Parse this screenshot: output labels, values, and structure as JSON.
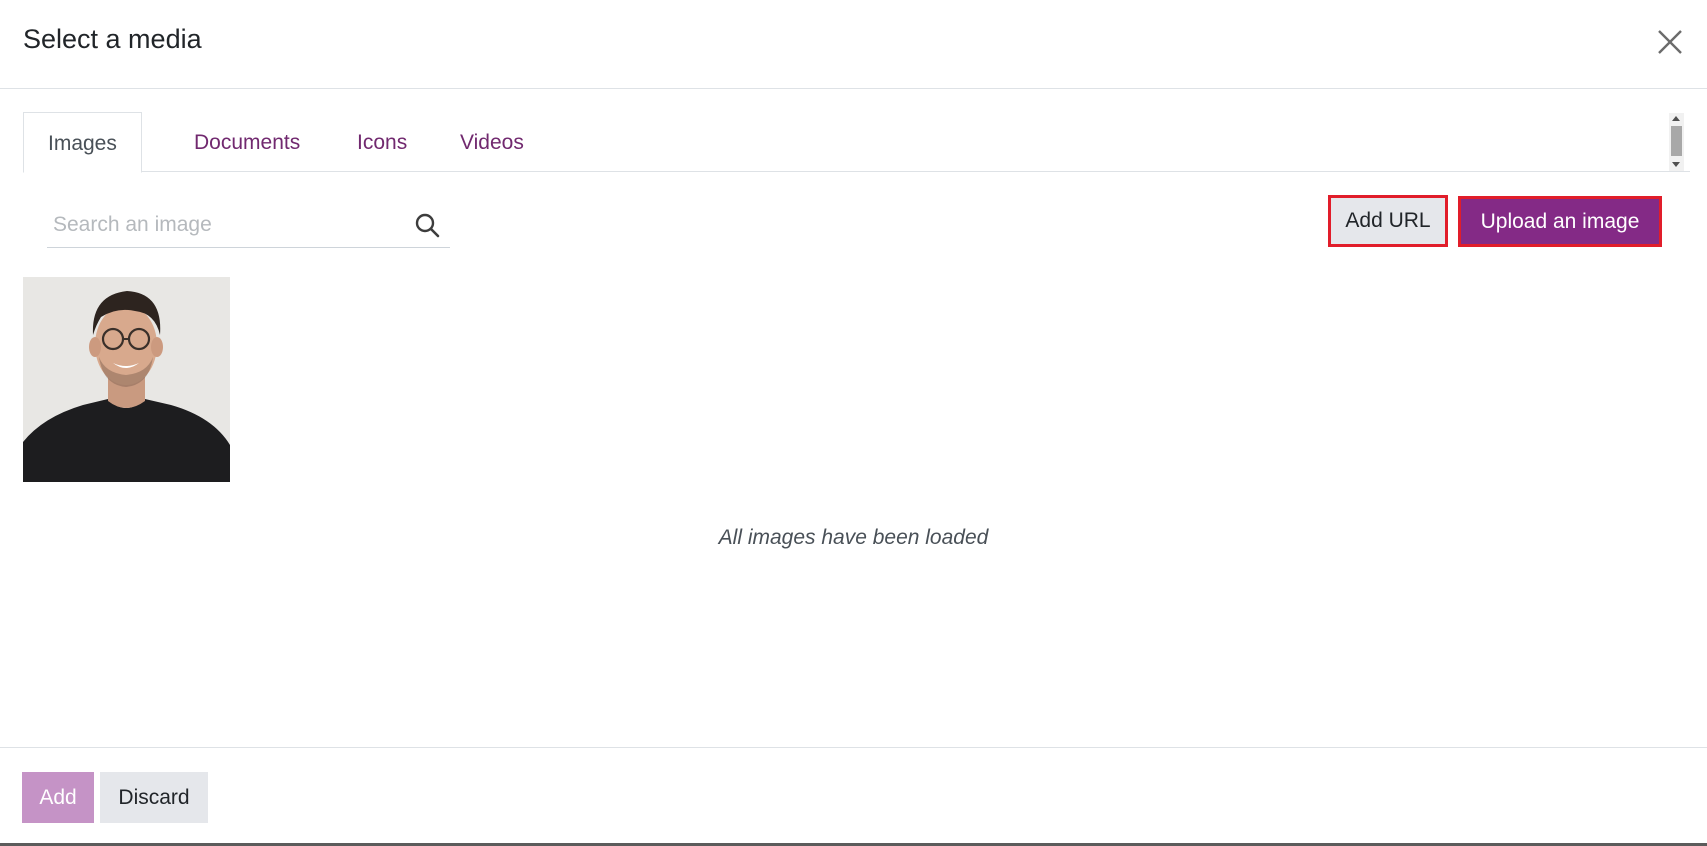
{
  "dialog": {
    "title": "Select a media",
    "close_label": "×"
  },
  "tabs": [
    {
      "label": "Images",
      "active": true
    },
    {
      "label": "Documents",
      "active": false
    },
    {
      "label": "Icons",
      "active": false
    },
    {
      "label": "Videos",
      "active": false
    }
  ],
  "search": {
    "placeholder": "Search an image",
    "value": ""
  },
  "actions": {
    "add_url_label": "Add URL",
    "upload_label": "Upload an image"
  },
  "media": {
    "items": [
      {
        "kind": "image",
        "subject": "portrait of a smiling man with glasses in a black t-shirt"
      }
    ],
    "status_message": "All images have been loaded"
  },
  "footer": {
    "add_label": "Add",
    "discard_label": "Discard"
  },
  "colors": {
    "brand_primary": "#842a86",
    "brand_primary_disabled": "#c593c6",
    "tab_link": "#71296f",
    "highlight_border": "#e11d2a",
    "secondary_button": "#e5e7eb"
  }
}
